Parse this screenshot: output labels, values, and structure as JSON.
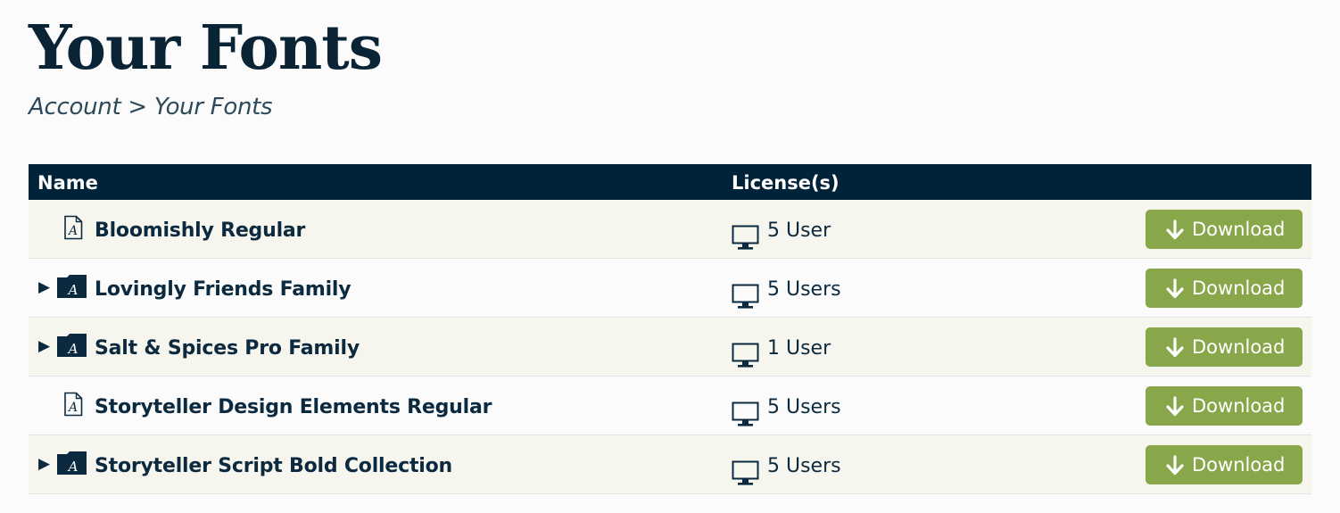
{
  "page": {
    "title": "Your Fonts"
  },
  "breadcrumb": {
    "root": "Account",
    "separator": ">",
    "current": "Your Fonts"
  },
  "table": {
    "headers": {
      "name": "Name",
      "license": "License(s)"
    },
    "rows": [
      {
        "type": "font",
        "expandable": false,
        "name": "Bloomishly Regular",
        "license": "5 User",
        "action": "Download"
      },
      {
        "type": "family",
        "expandable": true,
        "name": "Lovingly Friends Family",
        "license": "5 Users",
        "action": "Download"
      },
      {
        "type": "family",
        "expandable": true,
        "name": "Salt & Spices Pro Family",
        "license": "1 User",
        "action": "Download"
      },
      {
        "type": "font",
        "expandable": false,
        "name": "Storyteller Design Elements Regular",
        "license": "5 Users",
        "action": "Download"
      },
      {
        "type": "family",
        "expandable": true,
        "name": "Storyteller Script Bold Collection",
        "license": "5 Users",
        "action": "Download"
      }
    ]
  },
  "icons": {
    "expander": "expand-triangle-icon",
    "font_file": "font-file-icon",
    "font_folder": "font-folder-icon",
    "license": "monitor-icon",
    "download": "download-arrow-icon"
  },
  "colors": {
    "header_bg": "#00233a",
    "text": "#0c2a3f",
    "row_alt_bg": "#f6f5ee",
    "button_bg": "#88a74a",
    "button_text": "#ffffff"
  }
}
